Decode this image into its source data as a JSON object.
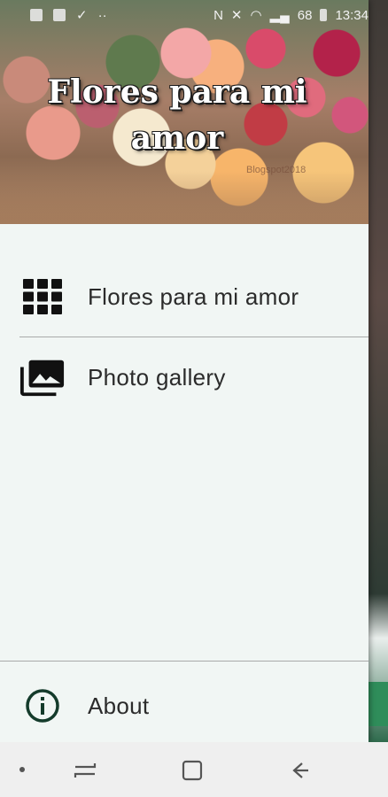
{
  "status_bar": {
    "time": "13:34",
    "battery": "68"
  },
  "drawer": {
    "header_title": "Flores para mi amor",
    "watermark": "Blogspot2018",
    "items": [
      {
        "label": "Flores para mi amor",
        "icon": "grid-icon"
      },
      {
        "label": "Photo gallery",
        "icon": "photo-gallery-icon"
      }
    ],
    "footer_item": {
      "label": "About",
      "icon": "info-icon"
    }
  },
  "colors": {
    "drawer_bg": "#f1f6f4",
    "icon_dark": "#111111",
    "info_icon": "#143b2b"
  }
}
